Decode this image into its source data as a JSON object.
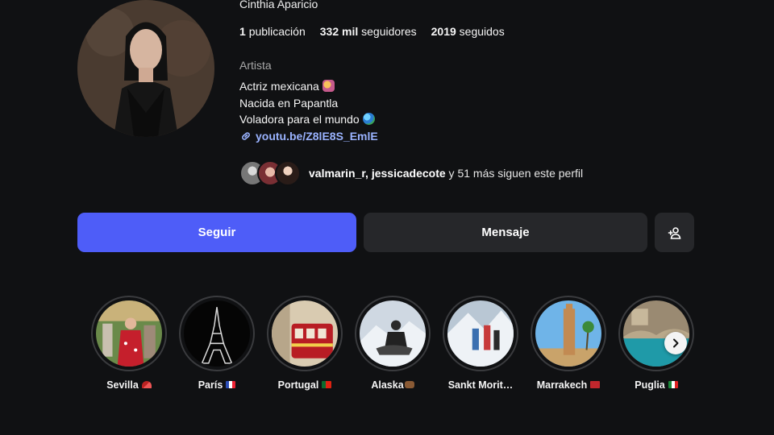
{
  "profile": {
    "name": "Cinthia Aparicio",
    "stats": {
      "posts_value": "1",
      "posts_label": "publicación",
      "followers_value": "332 mil",
      "followers_label": "seguidores",
      "following_value": "2019",
      "following_label": "seguidos"
    },
    "category": "Artista",
    "bio": [
      "Actriz mexicana",
      "Nacida en Papantla",
      "Voladora para el mundo"
    ],
    "link": "youtu.be/Z8lE8S_EmlE"
  },
  "followed_by": {
    "names": "valmarin_r, jessicadecote",
    "rest": " y 51 más siguen este perfil"
  },
  "actions": {
    "follow": "Seguir",
    "message": "Mensaje"
  },
  "highlights": [
    {
      "label": "Sevilla",
      "icon": "fan-icon"
    },
    {
      "label": "París",
      "icon": "flag-france-icon"
    },
    {
      "label": "Portugal",
      "icon": "flag-portugal-icon"
    },
    {
      "label": "Alaska",
      "icon": "moose-icon"
    },
    {
      "label": "Sankt Morit…",
      "icon": null
    },
    {
      "label": "Marrakech",
      "icon": "flag-morocco-icon"
    },
    {
      "label": "Puglia",
      "icon": "flag-italy-icon"
    }
  ],
  "colors": {
    "background": "#101113",
    "primary_button": "#4e5df8",
    "secondary_button": "#26272a",
    "link": "#9ab3ff"
  }
}
